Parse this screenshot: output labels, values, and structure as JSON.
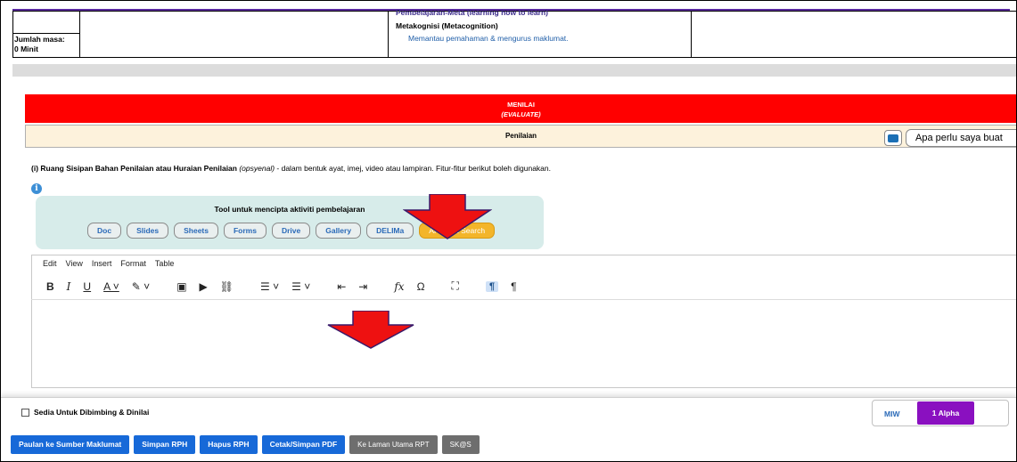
{
  "top_table": {
    "learning_line": "Pembelajaran-Meta (learning how to learn)",
    "metakognisi": "Metakognisi (Metacognition)",
    "memantau": "Memantau pemahaman & mengurus maklumat.",
    "jumlah_masa_label": "Jumlah masa:",
    "jumlah_masa_value": "0 Minit"
  },
  "section": {
    "title": "MENILAI",
    "subtitle": "(EVALUATE)",
    "sub_header": "Penilaian",
    "help_text": "Apa perlu saya buat"
  },
  "instruction": {
    "bold": "(i) Ruang Sisipan Bahan Penilaian atau Huraian Penilaian",
    "italic": " (opsyenal)",
    "rest": " - dalam bentuk ayat, imej, video atau lampiran. Fitur-fitur berikut boleh digunakan."
  },
  "toolbox": {
    "title": "Tool untuk mencipta aktiviti pembelajaran",
    "buttons": [
      "Doc",
      "Slides",
      "Sheets",
      "Forms",
      "Drive",
      "Gallery",
      "DELIMa",
      "AI-Smart Search"
    ]
  },
  "editor": {
    "menu": [
      "Edit",
      "View",
      "Insert",
      "Format",
      "Table"
    ]
  },
  "footer": {
    "checkbox_label": "Sedia Untuk Dibimbing & Dinilai",
    "mode_miw": "MIW",
    "mode_alpha": "1 Alpha",
    "actions": [
      "Paulan ke Sumber Maklumat",
      "Simpan RPH",
      "Hapus RPH",
      "Cetak/Simpan PDF"
    ],
    "secondary": [
      "Ke Laman Utama RPT",
      "SK@S"
    ]
  },
  "colors": {
    "header_red": "#ff0000",
    "toolbox_bg": "#d7ecea",
    "accent_blue": "#1769d8",
    "alpha_purple": "#8a10c0",
    "annotation_arrow": "#ee1111"
  }
}
